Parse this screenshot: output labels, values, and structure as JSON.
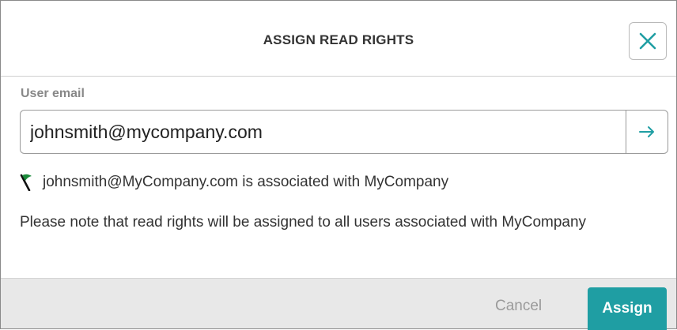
{
  "dialog": {
    "title": "ASSIGN READ RIGHTS",
    "close_icon": "close-icon"
  },
  "form": {
    "email_label": "User email",
    "email_value": "johnsmith@mycompany.com",
    "submit_icon": "arrow-right-icon"
  },
  "result": {
    "flag_icon": "flag-icon",
    "association_text": "johnsmith@MyCompany.com is associated with MyCompany",
    "note_text": "Please note that read rights will be assigned to all users associated with MyCompany"
  },
  "footer": {
    "cancel_label": "Cancel",
    "assign_label": "Assign"
  },
  "colors": {
    "accent": "#1f9ea3",
    "flag_green": "#1b8a3a",
    "footer_bg": "#e8e8e8"
  }
}
